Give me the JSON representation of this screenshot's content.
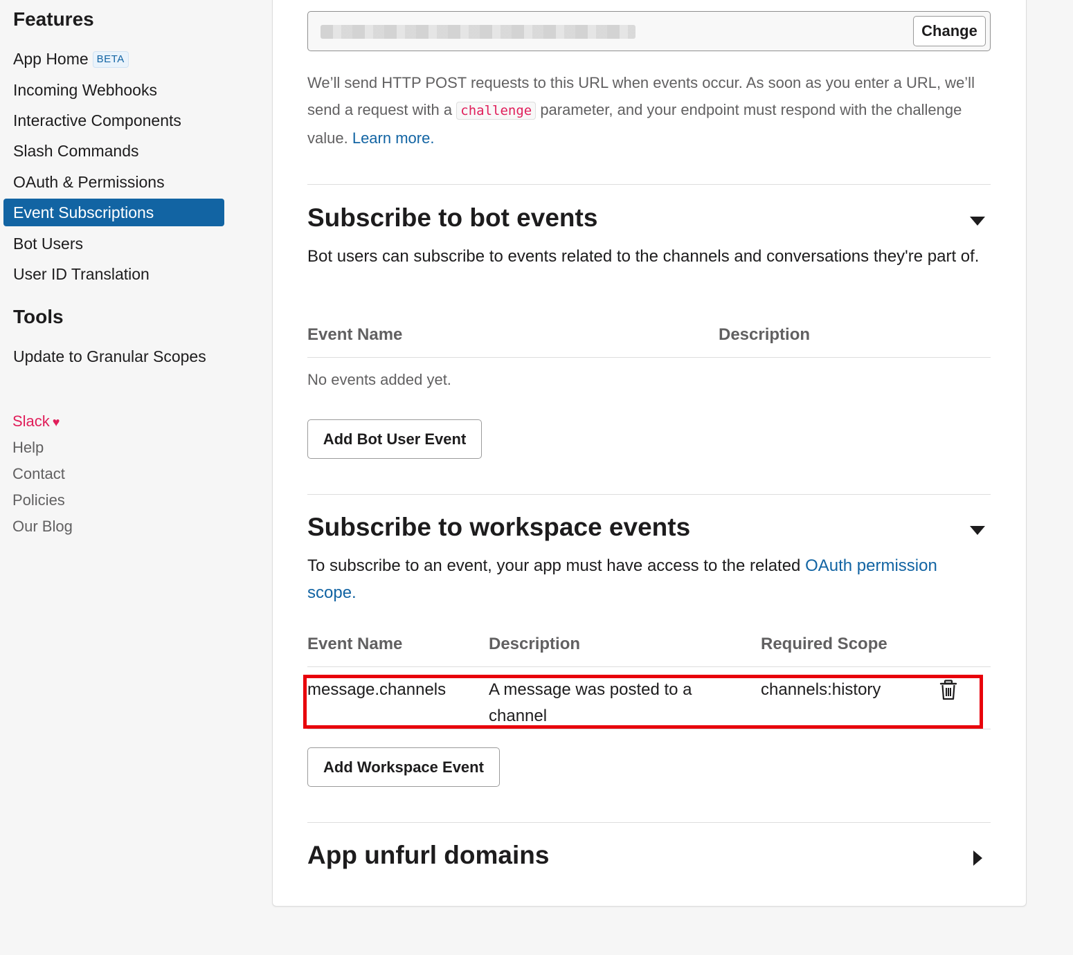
{
  "sidebar": {
    "features_heading": "Features",
    "items": [
      {
        "label": "App Home",
        "badge": "BETA"
      },
      {
        "label": "Incoming Webhooks"
      },
      {
        "label": "Interactive Components"
      },
      {
        "label": "Slash Commands"
      },
      {
        "label": "OAuth & Permissions"
      },
      {
        "label": "Event Subscriptions",
        "active": true
      },
      {
        "label": "Bot Users"
      },
      {
        "label": "User ID Translation"
      }
    ],
    "tools_heading": "Tools",
    "tools_items": [
      {
        "label": "Update to Granular Scopes"
      }
    ],
    "footer": {
      "slack": "Slack",
      "heart": "♥",
      "links": [
        "Help",
        "Contact",
        "Policies",
        "Our Blog"
      ]
    }
  },
  "request_url": {
    "change_label": "Change",
    "help_text_1": "We’ll send HTTP POST requests to this URL when events occur. As soon as you enter a URL, we’ll send a request with a ",
    "code": "challenge",
    "help_text_2": " parameter, and your endpoint must respond with the challenge value. ",
    "learn_more": "Learn more."
  },
  "bot_events": {
    "title": "Subscribe to bot events",
    "description": "Bot users can subscribe to events related to the channels and conversations they're part of.",
    "columns": [
      "Event Name",
      "Description"
    ],
    "empty_text": "No events added yet.",
    "add_button": "Add Bot User Event"
  },
  "workspace_events": {
    "title": "Subscribe to workspace events",
    "description_prefix": "To subscribe to an event, your app must have access to the related ",
    "description_link": "OAuth permission scope.",
    "columns": [
      "Event Name",
      "Description",
      "Required Scope"
    ],
    "rows": [
      {
        "event": "message.channels",
        "description": "A message was posted to a channel",
        "scope": "channels:history"
      }
    ],
    "add_button": "Add Workspace Event"
  },
  "unfurl": {
    "title": "App unfurl domains"
  },
  "colors": {
    "accent": "#1264a3",
    "highlight": "#e8000b",
    "slack_pink": "#e01e5a"
  }
}
